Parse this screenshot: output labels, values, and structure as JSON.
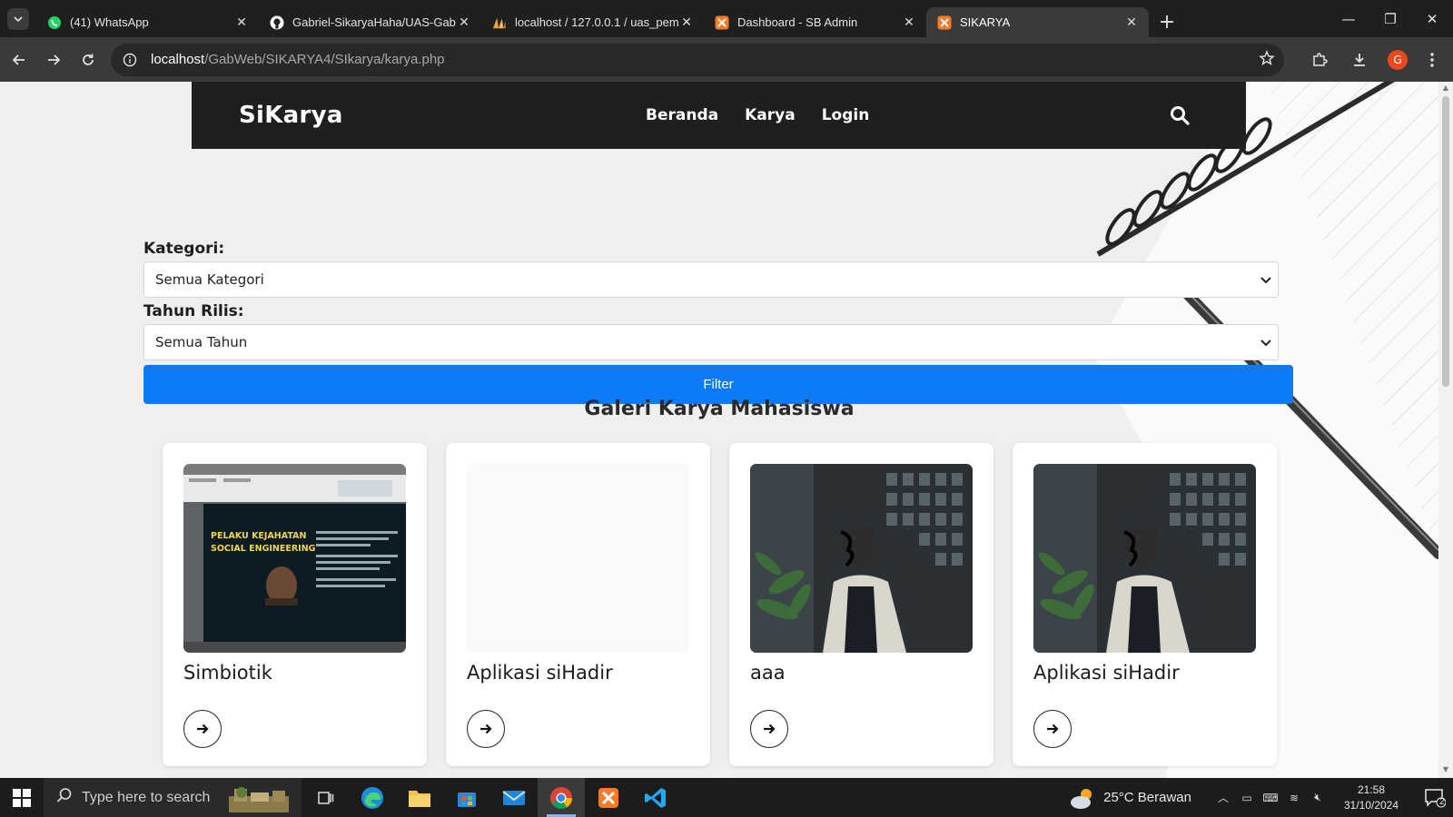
{
  "browser": {
    "tabs": [
      {
        "title": "(41) WhatsApp",
        "icon": "whatsapp-icon",
        "active": false
      },
      {
        "title": "Gabriel-SikaryaHaha/UAS-Gabr",
        "icon": "github-icon",
        "active": false
      },
      {
        "title": "localhost / 127.0.0.1 / uas_pem",
        "icon": "phpmyadmin-icon",
        "active": false
      },
      {
        "title": "Dashboard - SB Admin",
        "icon": "xampp-icon",
        "active": false
      },
      {
        "title": "SIKARYA",
        "icon": "xampp-icon",
        "active": true
      }
    ],
    "url_host": "localhost",
    "url_path": "/GabWeb/SIKARYA4/SIkarya/karya.php",
    "profile_initial": "G"
  },
  "site": {
    "brand": "SiKarya",
    "nav": [
      "Beranda",
      "Karya",
      "Login"
    ]
  },
  "filters": {
    "category_label": "Kategori:",
    "category_value": "Semua Kategori",
    "year_label": "Tahun Rilis:",
    "year_value": "Semua Tahun",
    "filter_button": "Filter"
  },
  "gallery": {
    "title": "Galeri Karya Mahasiswa",
    "cards": [
      {
        "title": "Simbiotik",
        "image": "presentation-screenshot",
        "thumb_text": "PELAKU KEJAHATAN\nSOCIAL ENGINEERING"
      },
      {
        "title": "Aplikasi siHadir",
        "image": "blank"
      },
      {
        "title": "aaa",
        "image": "person-photo"
      },
      {
        "title": "Aplikasi siHadir",
        "image": "person-photo"
      }
    ]
  },
  "taskbar": {
    "search_placeholder": "Type here to search",
    "weather": "25°C  Berawan",
    "time": "21:58",
    "date": "31/10/2024",
    "notification_count": "2"
  },
  "colors": {
    "primary_button": "#0d7bf5",
    "navbar": "#1f1f1f",
    "page_background": "#efefef"
  }
}
